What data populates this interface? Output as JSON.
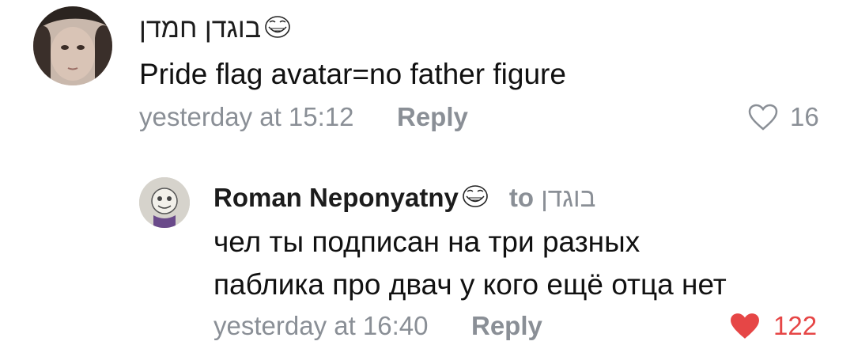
{
  "comments": [
    {
      "author": "בוגדן חמדן",
      "text": "Pride flag avatar=no father figure",
      "timestamp": "yesterday at 15:12",
      "reply_label": "Reply",
      "likes": "16",
      "liked": false,
      "author_icon": "trollface-icon"
    },
    {
      "author": "Roman Neponyatny",
      "to_prefix": "to",
      "to_name": "בוגדן",
      "text_line1": "чел ты подписан на три разных",
      "text_line2": "паблика про двач у кого ещё отца нет",
      "timestamp": "yesterday at 16:40",
      "reply_label": "Reply",
      "likes": "122",
      "liked": true,
      "author_icon": "trollface-icon"
    }
  ],
  "colors": {
    "meta_grey": "#8a8f96",
    "like_red": "#e64646"
  }
}
